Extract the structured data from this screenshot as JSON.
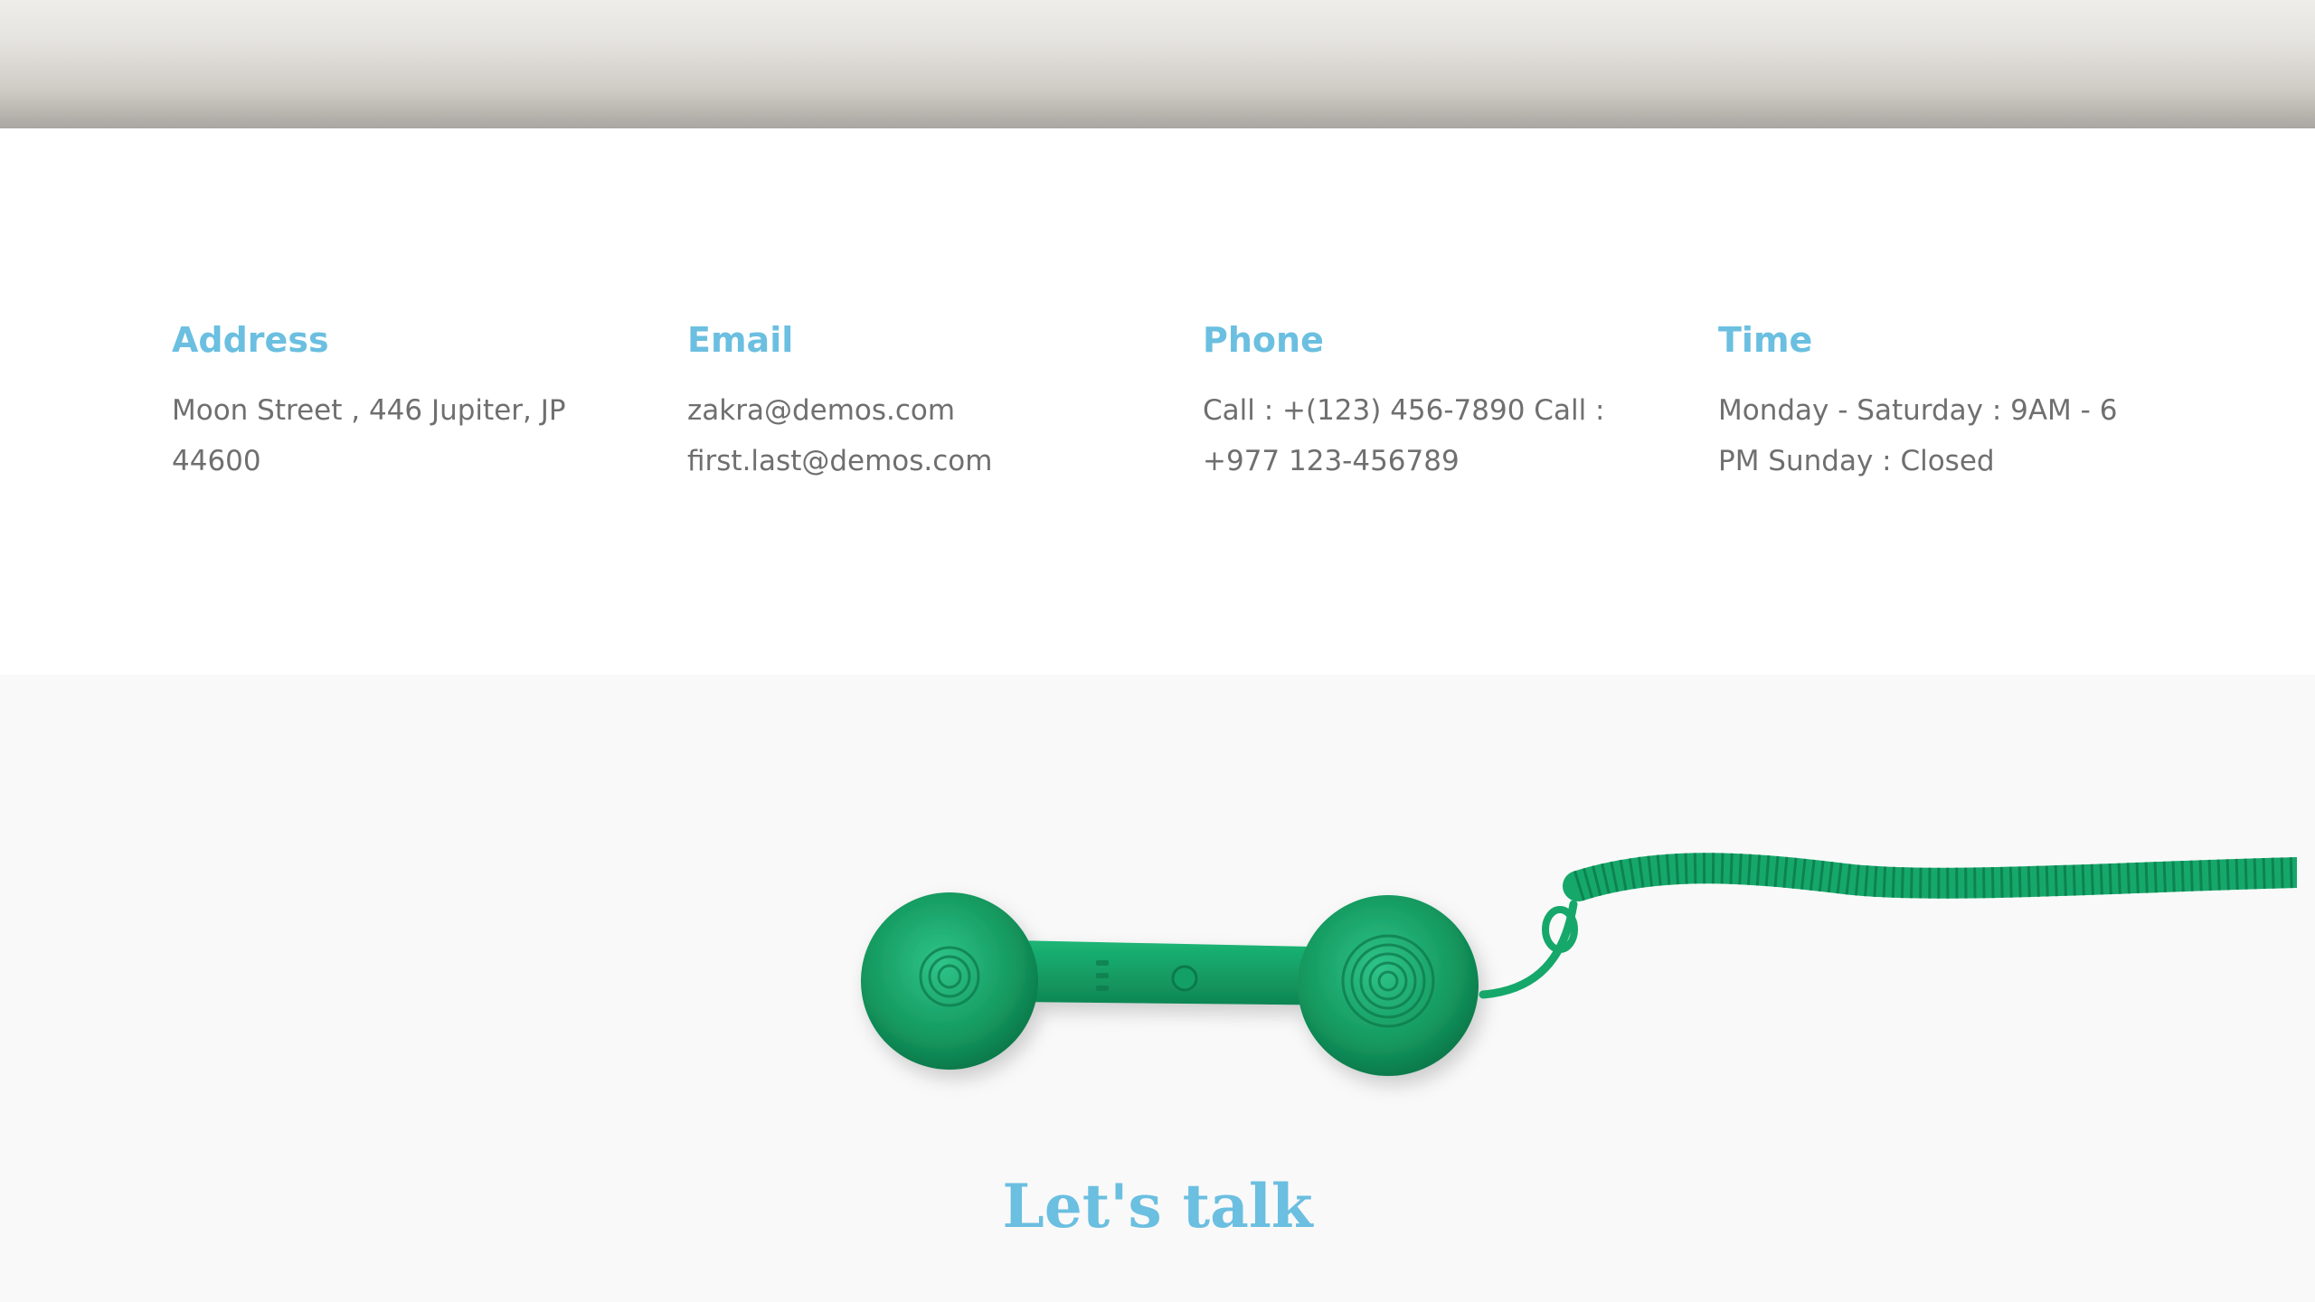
{
  "info": {
    "address": {
      "title": "Address",
      "text": "Moon Street , 446 Jupiter, JP 44600"
    },
    "email": {
      "title": "Email",
      "text_1": "zakra@demos.com",
      "text_2": "first.last@demos.com"
    },
    "phone": {
      "title": "Phone",
      "text": "Call : +(123) 456-7890 Call : +977 123-456789"
    },
    "time": {
      "title": "Time",
      "text": "Monday - Saturday : 9AM - 6 PM Sunday : Closed"
    }
  },
  "contact": {
    "heading": "Let's talk",
    "image": "green-telephone-handset-icon"
  },
  "colors": {
    "accent": "#6bbfe0",
    "body_text": "#6f6f6f",
    "phone_green": "#1aa36e",
    "section_bg": "#f9f9f9"
  }
}
